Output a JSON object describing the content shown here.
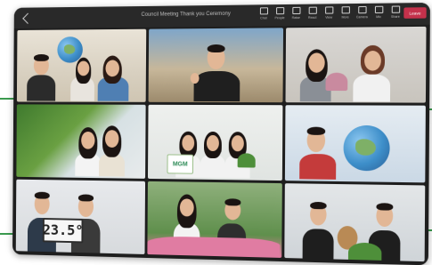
{
  "window": {
    "title": "Council Meeting Thank you Ceremony",
    "back_icon": "chevron-left-icon"
  },
  "toolbar": {
    "items": [
      {
        "label": "Chat",
        "icon": "chat-icon"
      },
      {
        "label": "People",
        "icon": "people-icon"
      },
      {
        "label": "Raise",
        "icon": "hand-icon"
      },
      {
        "label": "React",
        "icon": "smile-icon"
      },
      {
        "label": "View",
        "icon": "grid-icon"
      },
      {
        "label": "More",
        "icon": "more-icon"
      },
      {
        "label": "Camera",
        "icon": "camera-icon"
      },
      {
        "label": "Mic",
        "icon": "mic-icon"
      },
      {
        "label": "Share",
        "icon": "share-icon"
      }
    ],
    "leave_label": "Leave"
  },
  "tiles": [
    {
      "name": "",
      "scene": "globe-office"
    },
    {
      "name": "",
      "scene": "mall-thumbs-up"
    },
    {
      "name": "",
      "scene": "flowers"
    },
    {
      "name": "",
      "scene": "green-wall"
    },
    {
      "name": "",
      "scene": "sign"
    },
    {
      "name": "",
      "scene": "globe-man"
    },
    {
      "name": "",
      "scene": "clock",
      "display": "23.5°"
    },
    {
      "name": "",
      "scene": "garden"
    },
    {
      "name": "",
      "scene": "teddy"
    }
  ],
  "sign_text": "MGM",
  "colors": {
    "leave": "#c4314b",
    "accent_green": "#3a9a4e",
    "window_bg": "#1e1e1e"
  }
}
